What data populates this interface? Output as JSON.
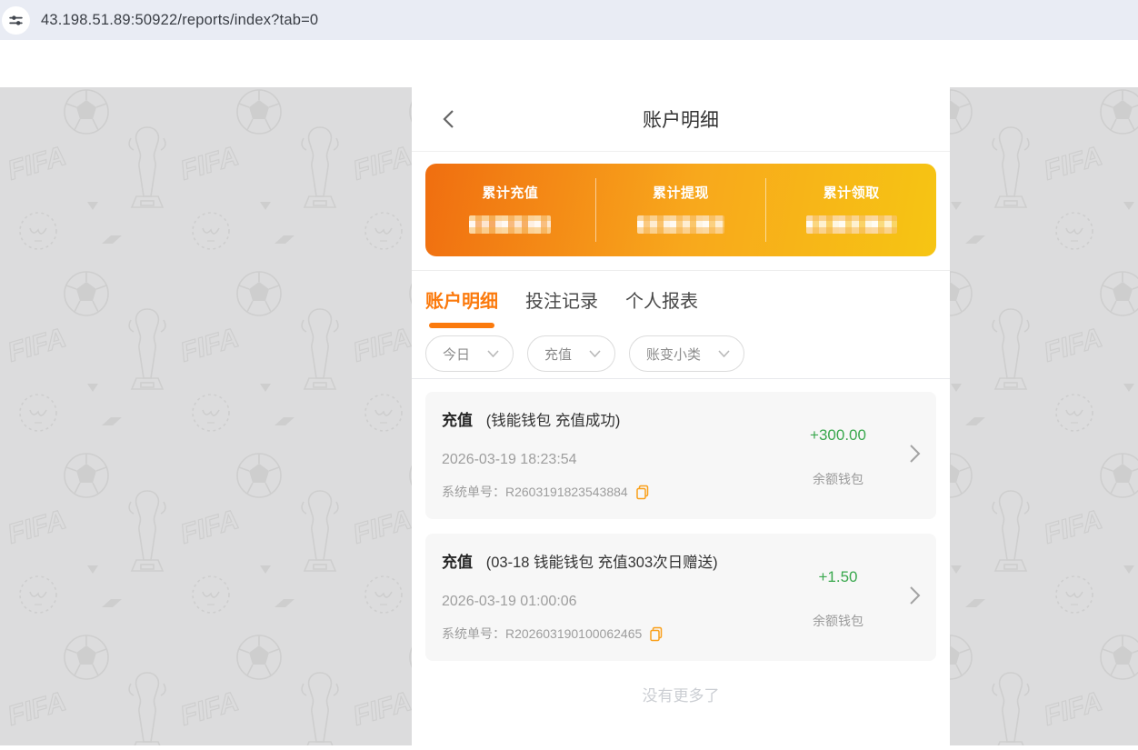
{
  "browser": {
    "url": "43.198.51.89:50922/reports/index?tab=0",
    "site_icon": "tune-icon"
  },
  "header": {
    "title": "账户明细",
    "back_icon": "chevron-left-icon"
  },
  "summary": {
    "items": [
      {
        "label": "累计充值",
        "value_masked": true
      },
      {
        "label": "累计提现",
        "value_masked": true
      },
      {
        "label": "累计领取",
        "value_masked": true
      }
    ]
  },
  "tabs": [
    {
      "label": "账户明细",
      "active": true
    },
    {
      "label": "投注记录",
      "active": false
    },
    {
      "label": "个人报表",
      "active": false
    }
  ],
  "filters": [
    {
      "label": "今日",
      "icon": "chevron-down-icon"
    },
    {
      "label": "充值",
      "icon": "chevron-down-icon"
    },
    {
      "label": "账变小类",
      "icon": "chevron-down-icon"
    }
  ],
  "transactions": [
    {
      "type": "充值",
      "note": "(钱能钱包 充值成功)",
      "datetime": "2026-03-19 18:23:54",
      "order_label": "系统单号：",
      "order_no": "R2603191823543884",
      "amount": "+300.00",
      "wallet": "余额钱包"
    },
    {
      "type": "充值",
      "note": "(03-18 钱能钱包 充值303次日赠送)",
      "datetime": "2026-03-19 01:00:06",
      "order_label": "系统单号：",
      "order_no": "R202603190100062465",
      "amount": "+1.50",
      "wallet": "余额钱包"
    }
  ],
  "list_end_text": "没有更多了",
  "colors": {
    "accent_orange": "#fb7a0d",
    "card_gradient_start": "#f06e10",
    "card_gradient_mid": "#f8a81c",
    "card_gradient_end": "#f6c513",
    "amount_green": "#3aa84e",
    "copy_icon_orange": "#f9a01b",
    "background_gray": "#dcdcdd",
    "pattern_stroke": "#c4c4c4",
    "browser_bar": "#e9ecf4"
  }
}
